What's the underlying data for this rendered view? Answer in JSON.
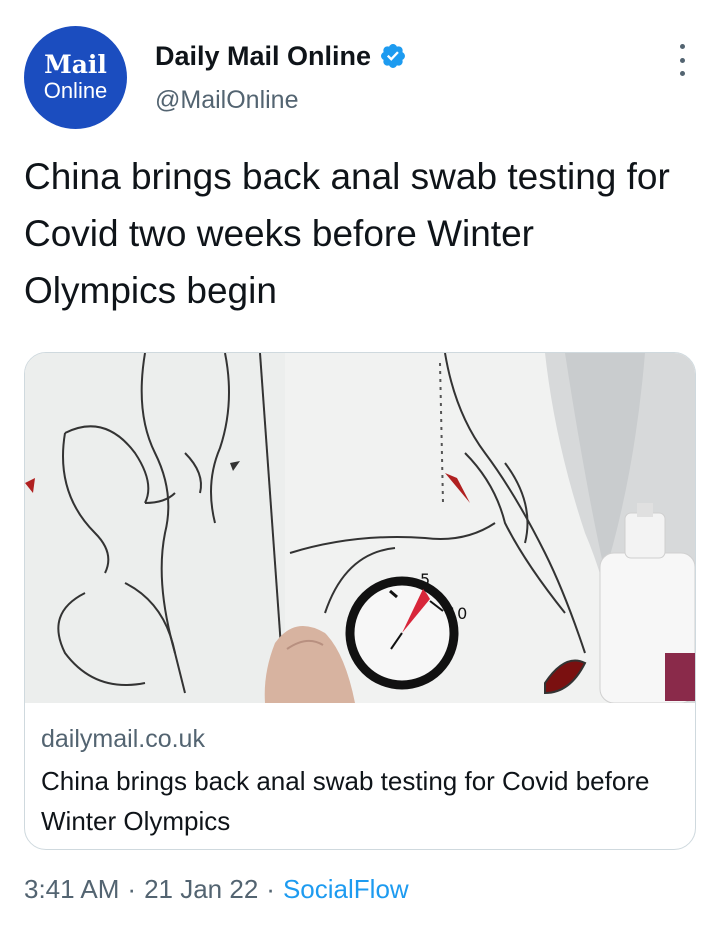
{
  "author": {
    "avatar_line1": "Mail",
    "avatar_line2": "Online",
    "display_name": "Daily Mail Online",
    "handle": "@MailOnline",
    "verified_icon": "verified-badge-icon"
  },
  "tweet": {
    "text": "China brings back anal swab testing for Covid two weeks before Winter Olympics begin"
  },
  "card": {
    "domain": "dailymail.co.uk",
    "title": "China brings back anal swab testing for Covid before Winter Olympics",
    "image_labels": {
      "mark_5": "5",
      "mark_10": "10"
    }
  },
  "meta": {
    "time": "3:41 AM",
    "date": "21 Jan 22",
    "separator": "·",
    "source": "SocialFlow"
  },
  "colors": {
    "brand_blue": "#1b4dbf",
    "link_blue": "#1d9bf0",
    "secondary_text": "#536471",
    "card_border": "#cfd9de"
  }
}
